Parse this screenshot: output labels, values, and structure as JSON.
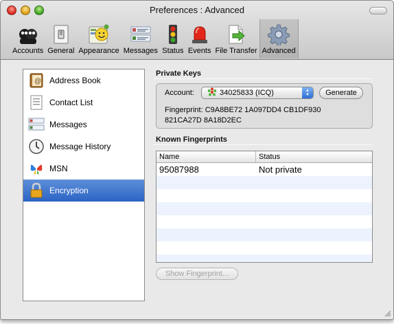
{
  "window": {
    "title": "Preferences : Advanced"
  },
  "toolbar": {
    "items": [
      {
        "label": "Accounts",
        "icon": "accounts-icon"
      },
      {
        "label": "General",
        "icon": "light-switch-icon"
      },
      {
        "label": "Appearance",
        "icon": "smiley-palette-icon"
      },
      {
        "label": "Messages",
        "icon": "messages-icon"
      },
      {
        "label": "Status",
        "icon": "traffic-light-icon"
      },
      {
        "label": "Events",
        "icon": "siren-icon"
      },
      {
        "label": "File Transfer",
        "icon": "file-transfer-icon"
      },
      {
        "label": "Advanced",
        "icon": "gear-icon"
      }
    ],
    "selected": "Advanced"
  },
  "sidebar": {
    "items": [
      {
        "label": "Address Book",
        "icon": "address-book-icon"
      },
      {
        "label": "Contact List",
        "icon": "contact-list-icon"
      },
      {
        "label": "Messages",
        "icon": "messages-icon"
      },
      {
        "label": "Message History",
        "icon": "clock-icon"
      },
      {
        "label": "MSN",
        "icon": "msn-butterfly-icon"
      },
      {
        "label": "Encryption",
        "icon": "padlock-icon"
      }
    ],
    "selected": "Encryption"
  },
  "private_keys": {
    "heading": "Private Keys",
    "account_label": "Account:",
    "account_value": "34025833 (ICQ)",
    "generate_label": "Generate",
    "fingerprint_line1": "Fingerprint: C9A8BE72 1A097DD4 CB1DF930",
    "fingerprint_line2": "821CA27D 8A18D2EC"
  },
  "known_fingerprints": {
    "heading": "Known Fingerprints",
    "columns": [
      "Name",
      "Status"
    ],
    "rows": [
      {
        "name": "95087988",
        "status": "Not private"
      }
    ],
    "show_button_label": "Show Fingerprint..."
  },
  "colors": {
    "selection": "#3b71cf",
    "alt_row": "#edf3fe",
    "window_bg": "#e9e9e9"
  }
}
